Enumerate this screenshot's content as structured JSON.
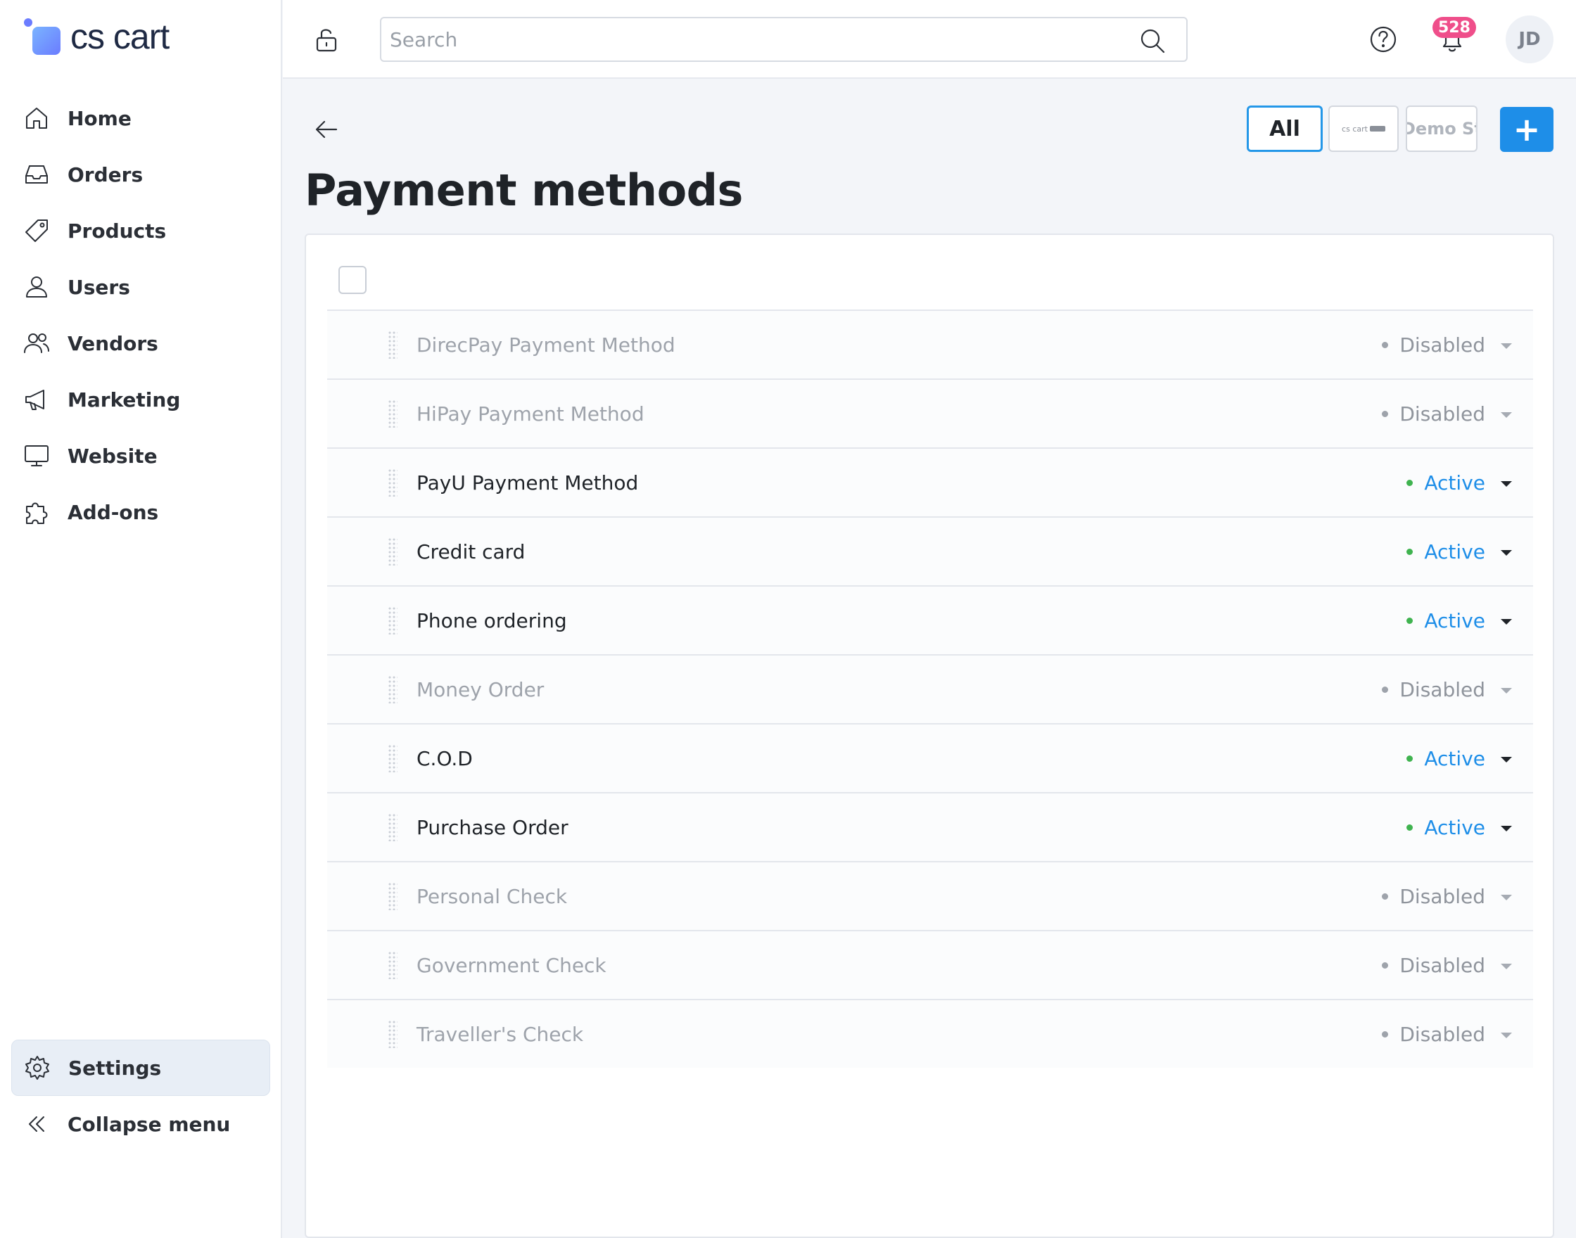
{
  "app": {
    "logo_text": "cs cart"
  },
  "sidebar": {
    "items": [
      {
        "label": "Home",
        "icon": "home-icon"
      },
      {
        "label": "Orders",
        "icon": "inbox-icon"
      },
      {
        "label": "Products",
        "icon": "tag-icon"
      },
      {
        "label": "Users",
        "icon": "user-icon"
      },
      {
        "label": "Vendors",
        "icon": "users-icon"
      },
      {
        "label": "Marketing",
        "icon": "megaphone-icon"
      },
      {
        "label": "Website",
        "icon": "monitor-icon"
      },
      {
        "label": "Add-ons",
        "icon": "puzzle-icon"
      }
    ],
    "settings_label": "Settings",
    "collapse_label": "Collapse menu"
  },
  "topbar": {
    "search_placeholder": "Search",
    "notifications_count": "528",
    "avatar_initials": "JD"
  },
  "header": {
    "title": "Payment methods",
    "store_all_label": "All",
    "store_cs_label": "cs cart",
    "store_demo_label": "Demo Store",
    "add_label": "+"
  },
  "payment_methods": [
    {
      "name": "DirecPay Payment Method",
      "status": "Disabled"
    },
    {
      "name": "HiPay Payment Method",
      "status": "Disabled"
    },
    {
      "name": "PayU Payment Method",
      "status": "Active"
    },
    {
      "name": "Credit card",
      "status": "Active"
    },
    {
      "name": "Phone ordering",
      "status": "Active"
    },
    {
      "name": "Money Order",
      "status": "Disabled"
    },
    {
      "name": "C.O.D",
      "status": "Active"
    },
    {
      "name": "Purchase Order",
      "status": "Active"
    },
    {
      "name": "Personal Check",
      "status": "Disabled"
    },
    {
      "name": "Government Check",
      "status": "Disabled"
    },
    {
      "name": "Traveller's Check",
      "status": "Disabled"
    }
  ],
  "colors": {
    "accent": "#1e8ee8",
    "active_dot": "#3fb34f",
    "badge": "#ef4e8a"
  }
}
